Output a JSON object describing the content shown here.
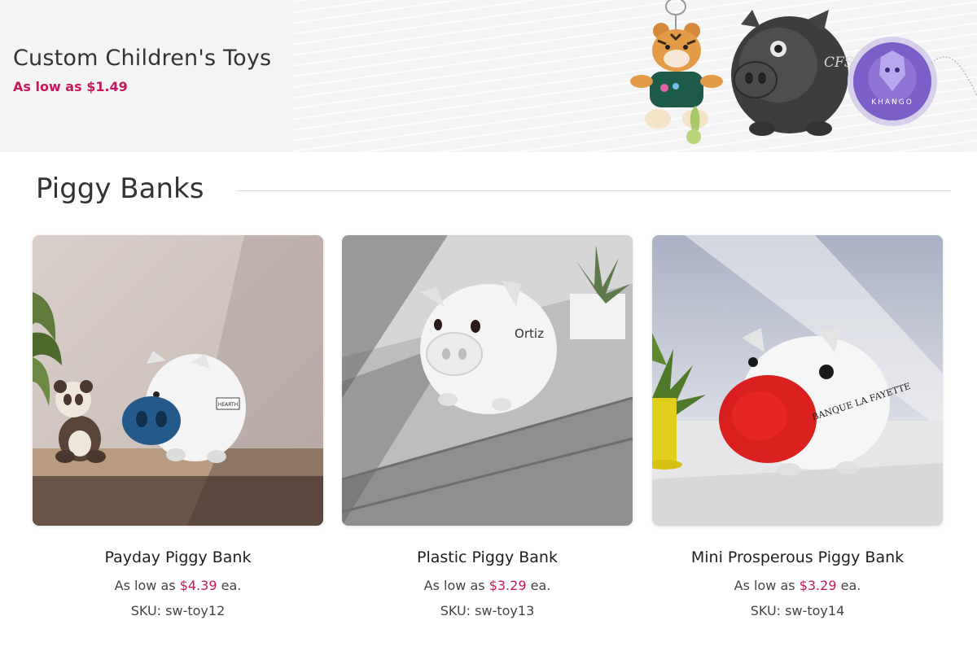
{
  "hero": {
    "title": "Custom Children's Toys",
    "subtitle_prefix": "As low as",
    "subtitle_price": "$1.49",
    "accent_color": "#c8175f",
    "yoyo_logo_text": "KHANGO",
    "bank_logo_text": "CFS"
  },
  "section": {
    "title": "Piggy Banks"
  },
  "products": [
    {
      "name": "Payday Piggy Bank",
      "price_prefix": "As low as",
      "price": "$4.39",
      "price_suffix": "ea.",
      "sku": "SKU: sw-toy12",
      "imprint": "HEARTH"
    },
    {
      "name": "Plastic Piggy Bank",
      "price_prefix": "As low as",
      "price": "$3.29",
      "price_suffix": "ea.",
      "sku": "SKU: sw-toy13",
      "imprint": "Ortiz"
    },
    {
      "name": "Mini Prosperous Piggy Bank",
      "price_prefix": "As low as",
      "price": "$3.29",
      "price_suffix": "ea.",
      "sku": "SKU: sw-toy14",
      "imprint": "BANQUE LA FAYETTE"
    }
  ]
}
